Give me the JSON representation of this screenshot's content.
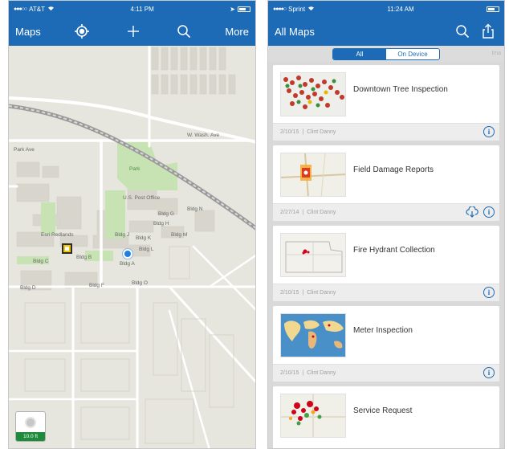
{
  "left_phone": {
    "status": {
      "carrier": "AT&T",
      "time": "4:11 PM"
    },
    "nav": {
      "maps_label": "Maps",
      "more_label": "More",
      "gps_icon": "gps-target-icon",
      "add_icon": "plus-icon",
      "search_icon": "search-icon"
    },
    "map_labels": {
      "park_ave": "Park Ave",
      "w_wash_ave": "W. Wash. Ave",
      "park": "Park",
      "post_office": "U.S. Post Office",
      "bldg_h": "Bldg H",
      "bldg_g": "Bldg G",
      "bldg_m": "Bldg M",
      "bldg_b": "Bldg B",
      "bldg_c": "Bldg C",
      "bldg_d": "Bldg D",
      "bldg_j": "Bldg J",
      "bldg_k": "Bldg K",
      "bldg_l": "Bldg L",
      "bldg_n": "Bldg N",
      "bldg_o": "Bldg O",
      "bldg_a": "Bldg A",
      "bldg_f": "Bldg F",
      "esri_redlands": "Esri Redlands"
    },
    "gps_accuracy": "10.0 ft"
  },
  "right_phone": {
    "status": {
      "carrier": "Sprint",
      "time": "11:24 AM"
    },
    "nav": {
      "title": "All Maps",
      "search_icon": "search-icon",
      "share_icon": "share-icon"
    },
    "segments": {
      "all": "All",
      "on_device": "On Device",
      "extra": "Ima"
    },
    "maps": [
      {
        "title": "Downtown Tree Inspection",
        "date": "2/10/15",
        "owner": "Clint Danny"
      },
      {
        "title": "Field Damage Reports",
        "date": "2/27/14",
        "owner": "Clint Danny"
      },
      {
        "title": "Fire Hydrant Collection",
        "date": "2/10/15",
        "owner": "Clint Danny"
      },
      {
        "title": "Meter Inspection",
        "date": "2/10/15",
        "owner": "Clint Danny"
      },
      {
        "title": "Service Request",
        "date": "",
        "owner": ""
      }
    ]
  },
  "colors": {
    "brand_blue": "#1d6bb6",
    "gps_green": "#1e8a3c",
    "map_bg": "#e6e5de",
    "park_green": "#c7e3b4"
  }
}
